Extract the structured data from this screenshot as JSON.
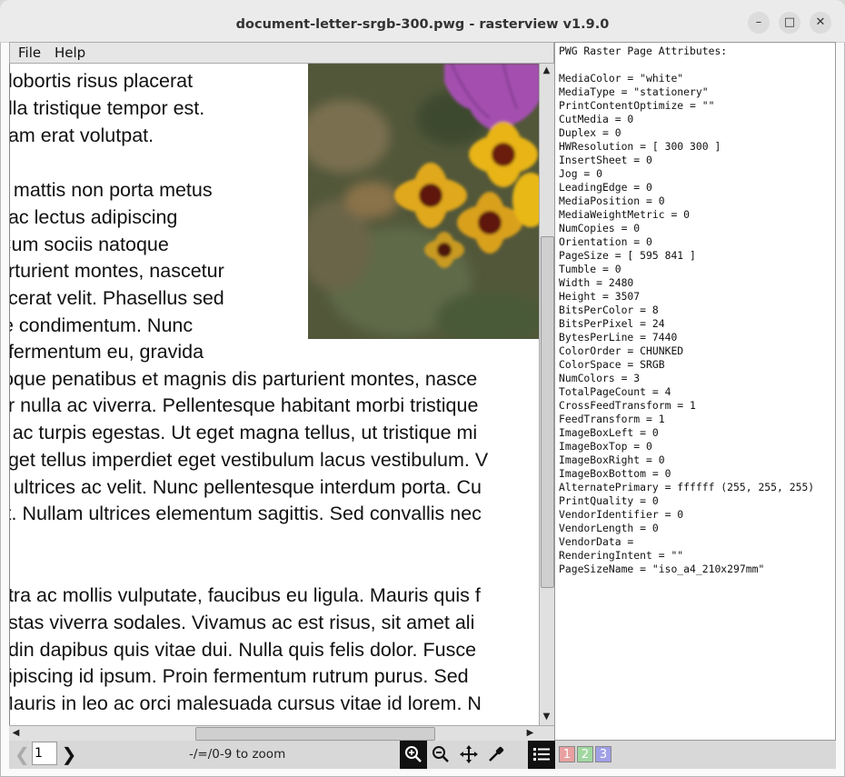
{
  "window": {
    "title": "document-letter-srgb-300.pwg - rasterview v1.9.0",
    "minimize_glyph": "–",
    "maximize_glyph": "□",
    "close_glyph": "✕"
  },
  "menu": {
    "file": "File",
    "help": "Help"
  },
  "document": {
    "lines": [
      "t lobortis risus placerat",
      "ulla tristique tempor est.",
      "uam erat volutpat.",
      "e mattis non porta metus",
      "t ac lectus adipiscing",
      "Cum sociis natoque",
      "arturient montes, nascetur",
      "acerat velit. Phasellus sed",
      "te condimentum. Nunc",
      "t fermentum eu, gravida",
      "toque penatibus et magnis dis parturient montes, nasce",
      "ar nulla ac viverra. Pellentesque habitant morbi tristique",
      "s ac turpis egestas. Ut eget magna tellus, ut tristique mi",
      "eget tellus imperdiet eget vestibulum lacus vestibulum. V",
      "t, ultrices ac velit. Nunc pellentesque interdum porta. Cu",
      "lit. Nullam ultrices elementum sagittis. Sed convallis nec",
      "etra ac mollis vulputate, faucibus eu ligula. Mauris quis f",
      "estas viverra sodales. Vivamus ac est risus, sit amet ali",
      "udin dapibus quis vitae dui. Nulla quis felis dolor. Fusce",
      "dipiscing id ipsum. Proin fermentum rutrum purus. Sed",
      "Mauris in leo ac orci malesuada cursus vitae id lorem. N"
    ]
  },
  "attributes": {
    "header": "PWG Raster Page Attributes:",
    "items": [
      "MediaColor = \"white\"",
      "MediaType = \"stationery\"",
      "PrintContentOptimize = \"\"",
      "CutMedia = 0",
      "Duplex = 0",
      "HWResolution = [ 300 300 ]",
      "InsertSheet = 0",
      "Jog = 0",
      "LeadingEdge = 0",
      "MediaPosition = 0",
      "MediaWeightMetric = 0",
      "NumCopies = 0",
      "Orientation = 0",
      "PageSize = [ 595 841 ]",
      "Tumble = 0",
      "Width = 2480",
      "Height = 3507",
      "BitsPerColor = 8",
      "BitsPerPixel = 24",
      "BytesPerLine = 7440",
      "ColorOrder = CHUNKED",
      "ColorSpace = SRGB",
      "NumColors = 3",
      "TotalPageCount = 4",
      "CrossFeedTransform = 1",
      "FeedTransform = 1",
      "ImageBoxLeft = 0",
      "ImageBoxTop = 0",
      "ImageBoxRight = 0",
      "ImageBoxBottom = 0",
      "AlternatePrimary = ffffff (255, 255, 255)",
      "PrintQuality = 0",
      "VendorIdentifier = 0",
      "VendorLength = 0",
      "VendorData =",
      "RenderingIntent = \"\"",
      "PageSizeName = \"iso_a4_210x297mm\""
    ]
  },
  "toolbar": {
    "page_value": "1",
    "zoom_hint": "-/=/0-9 to zoom",
    "page_badges": [
      "1",
      "2",
      "3"
    ],
    "badge_colors": [
      "#e8a0a0",
      "#a0d8a0",
      "#a0a0e8"
    ]
  }
}
